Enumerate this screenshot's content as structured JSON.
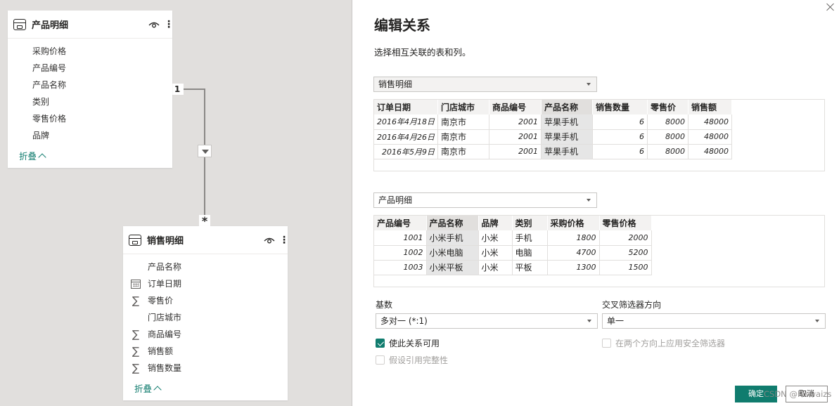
{
  "canvas": {
    "product_card": {
      "title": "产品明细",
      "fields": [
        {
          "label": "采购价格",
          "icon": ""
        },
        {
          "label": "产品编号",
          "icon": ""
        },
        {
          "label": "产品名称",
          "icon": ""
        },
        {
          "label": "类别",
          "icon": ""
        },
        {
          "label": "零售价格",
          "icon": ""
        },
        {
          "label": "品牌",
          "icon": ""
        }
      ],
      "collapse_label": "折叠"
    },
    "sales_card": {
      "title": "销售明细",
      "fields": [
        {
          "label": "产品名称",
          "icon": ""
        },
        {
          "label": "订单日期",
          "icon": "calendar-icon"
        },
        {
          "label": "零售价",
          "icon": "sigma-icon"
        },
        {
          "label": "门店城市",
          "icon": ""
        },
        {
          "label": "商品编号",
          "icon": "sigma-icon"
        },
        {
          "label": "销售额",
          "icon": "sigma-icon"
        },
        {
          "label": "销售数量",
          "icon": "sigma-icon"
        }
      ],
      "collapse_label": "折叠"
    },
    "relationship": {
      "one_side": "1",
      "many_side": "*"
    }
  },
  "pane": {
    "title": "编辑关系",
    "subtitle": "选择相互关联的表和列。",
    "table1": {
      "selected": "销售明细",
      "columns": [
        "订单日期",
        "门店城市",
        "商品编号",
        "产品名称",
        "销售数量",
        "零售价",
        "销售额"
      ],
      "rows": [
        [
          "2016年4月18日",
          "南京市",
          "2001",
          "苹果手机",
          "6",
          "8000",
          "48000"
        ],
        [
          "2016年4月26日",
          "南京市",
          "2001",
          "苹果手机",
          "6",
          "8000",
          "48000"
        ],
        [
          "2016年5月9日",
          "南京市",
          "2001",
          "苹果手机",
          "6",
          "8000",
          "48000"
        ]
      ]
    },
    "table2": {
      "selected": "产品明细",
      "columns": [
        "产品编号",
        "产品名称",
        "品牌",
        "类别",
        "采购价格",
        "零售价格"
      ],
      "rows": [
        [
          "1001",
          "小米手机",
          "小米",
          "手机",
          "1800",
          "2000"
        ],
        [
          "1002",
          "小米电脑",
          "小米",
          "电脑",
          "4700",
          "5200"
        ],
        [
          "1003",
          "小米平板",
          "小米",
          "平板",
          "1300",
          "1500"
        ]
      ]
    },
    "cardinality": {
      "label": "基数",
      "value": "多对一 (*:1)"
    },
    "cross_filter": {
      "label": "交叉筛选器方向",
      "value": "单一"
    },
    "activate": {
      "label": "使此关系可用",
      "checked": true
    },
    "security_filter": {
      "label": "在两个方向上应用安全筛选器",
      "checked": false
    },
    "ref_integrity": {
      "label": "假设引用完整性",
      "checked": false
    },
    "ok_label": "确定",
    "cancel_label": "取消",
    "watermark": "CSDN @hwwaizs"
  },
  "colors": {
    "accent": "#107c6e",
    "canvas_bg": "#e1dfdd"
  }
}
